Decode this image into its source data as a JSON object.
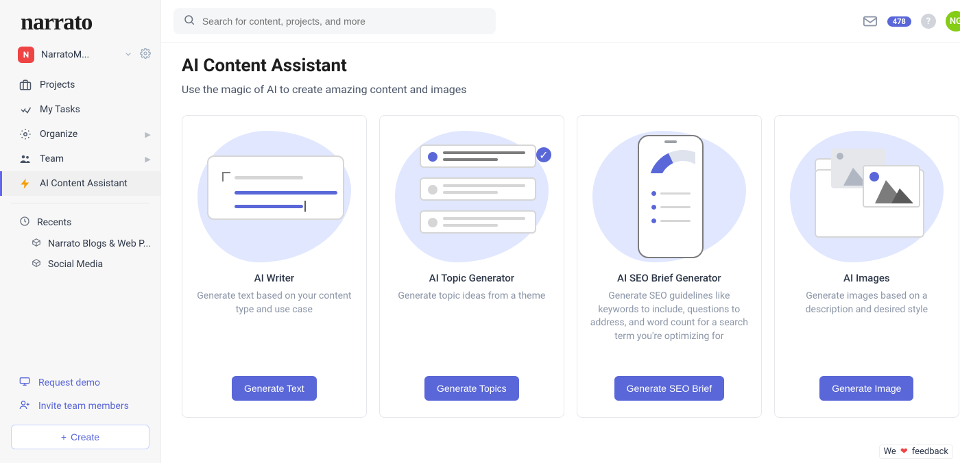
{
  "logo": "narrato",
  "workspace": {
    "initial": "N",
    "name": "NarratoM..."
  },
  "nav": {
    "projects": "Projects",
    "my_tasks": "My Tasks",
    "organize": "Organize",
    "team": "Team",
    "ai_content": "AI Content Assistant"
  },
  "recents": {
    "label": "Recents",
    "items": [
      "Narrato Blogs & Web P...",
      "Social Media"
    ]
  },
  "sidebar_bottom": {
    "request_demo": "Request demo",
    "invite": "Invite team members",
    "create": "Create"
  },
  "search": {
    "placeholder": "Search for content, projects, and more"
  },
  "topbar": {
    "badge_count": "478",
    "avatar_initials": "NG"
  },
  "page": {
    "title": "AI Content Assistant",
    "subtitle": "Use the magic of AI to create amazing content and images"
  },
  "cards": [
    {
      "title": "AI Writer",
      "desc": "Generate text based on your content type and use case",
      "cta": "Generate Text"
    },
    {
      "title": "AI Topic Generator",
      "desc": "Generate topic ideas from a theme",
      "cta": "Generate Topics"
    },
    {
      "title": "AI SEO Brief Generator",
      "desc": "Generate SEO guidelines like keywords to include, questions to address, and word count for a search term you're optimizing for",
      "cta": "Generate SEO Brief"
    },
    {
      "title": "AI Images",
      "desc": "Generate images based on a description and desired style",
      "cta": "Generate Image"
    }
  ],
  "feedback": {
    "pre": "We",
    "post": "feedback"
  }
}
